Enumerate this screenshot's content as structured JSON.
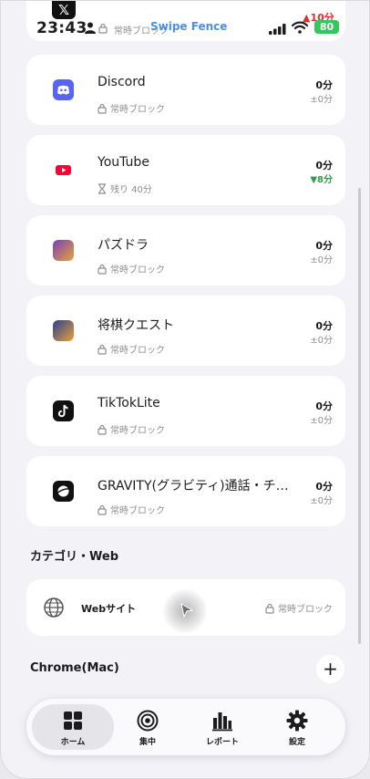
{
  "status_bar": {
    "time": "23:43",
    "app_name": "Swipe Fence",
    "battery": "80",
    "top_card_red": "▲10分",
    "top_card_status": "常時ブロック"
  },
  "apps": [
    {
      "name": "Discord",
      "status": "常時ブロック",
      "time": "0分",
      "delta": "±0分",
      "delta_color": "gray",
      "icon": "discord-icon",
      "color": "#5865f2"
    },
    {
      "name": "YouTube",
      "status": "残り 40分",
      "time": "0分",
      "delta": "▼8分",
      "delta_color": "green",
      "icon": "youtube-icon",
      "color": "#ff0033"
    },
    {
      "name": "パズドラ",
      "status": "常時ブロック",
      "time": "0分",
      "delta": "±0分",
      "delta_color": "gray",
      "icon": "puzzle-dragons-icon",
      "color": "#7a3fb8"
    },
    {
      "name": "将棋クエスト",
      "status": "常時ブロック",
      "time": "0分",
      "delta": "±0分",
      "delta_color": "gray",
      "icon": "shogi-quest-icon",
      "color": "#2a3f8f"
    },
    {
      "name": "TikTokLite",
      "status": "常時ブロック",
      "time": "0分",
      "delta": "±0分",
      "delta_color": "gray",
      "icon": "tiktok-icon",
      "color": "#111111"
    },
    {
      "name": "GRAVITY(グラビティ)通話・チ…",
      "status": "常時ブロック",
      "time": "0分",
      "delta": "±0分",
      "delta_color": "gray",
      "icon": "gravity-icon",
      "color": "#111111"
    }
  ],
  "category_section": {
    "title": "カテゴリ・Web",
    "web_label": "Webサイト",
    "web_status": "常時ブロック"
  },
  "chrome_section": {
    "title": "Chrome(Mac)",
    "add_label": "+"
  },
  "tabs": [
    {
      "label": "ホーム",
      "icon": "home-grid-icon",
      "active": true
    },
    {
      "label": "集中",
      "icon": "focus-target-icon",
      "active": false
    },
    {
      "label": "レポート",
      "icon": "report-chart-icon",
      "active": false
    },
    {
      "label": "設定",
      "icon": "settings-gear-icon",
      "active": false
    }
  ]
}
